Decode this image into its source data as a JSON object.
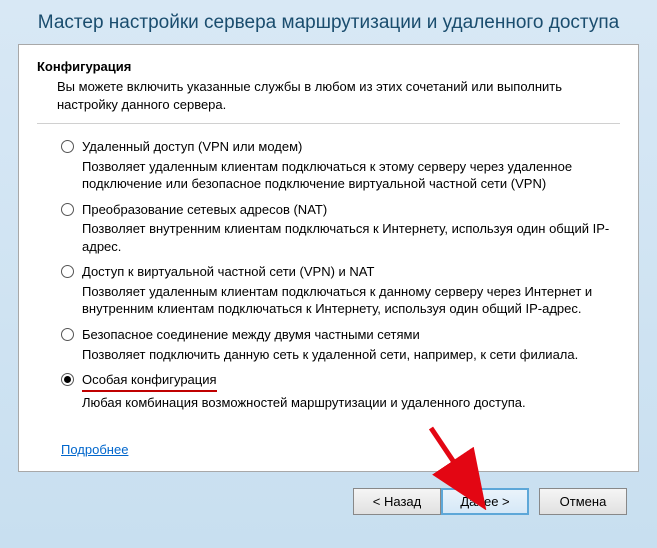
{
  "title": "Мастер настройки сервера маршрутизации и удаленного доступа",
  "section": {
    "heading": "Конфигурация",
    "description": "Вы можете включить указанные службы в любом из этих сочетаний или выполнить настройку данного сервера."
  },
  "options": [
    {
      "label": "Удаленный доступ (VPN или модем)",
      "desc": "Позволяет удаленным клиентам подключаться к этому серверу через удаленное подключение или безопасное подключение виртуальной частной сети (VPN)",
      "selected": false,
      "underlined": false
    },
    {
      "label": "Преобразование сетевых адресов (NAT)",
      "desc": "Позволяет внутренним клиентам подключаться к Интернету, используя один общий IP-адрес.",
      "selected": false,
      "underlined": false
    },
    {
      "label": "Доступ к виртуальной частной сети (VPN) и NAT",
      "desc": "Позволяет удаленным клиентам подключаться к данному серверу через Интернет и внутренним клиентам подключаться к Интернету, используя один общий IP-адрес.",
      "selected": false,
      "underlined": false
    },
    {
      "label": "Безопасное соединение между двумя частными сетями",
      "desc": "Позволяет подключить данную сеть к удаленной сети, например, к сети филиала.",
      "selected": false,
      "underlined": false
    },
    {
      "label": "Особая конфигурация",
      "desc": "Любая комбинация возможностей маршрутизации и удаленного доступа.",
      "selected": true,
      "underlined": true
    }
  ],
  "link": "Подробнее",
  "buttons": {
    "back": "< Назад",
    "next": "Далее >",
    "cancel": "Отмена"
  }
}
